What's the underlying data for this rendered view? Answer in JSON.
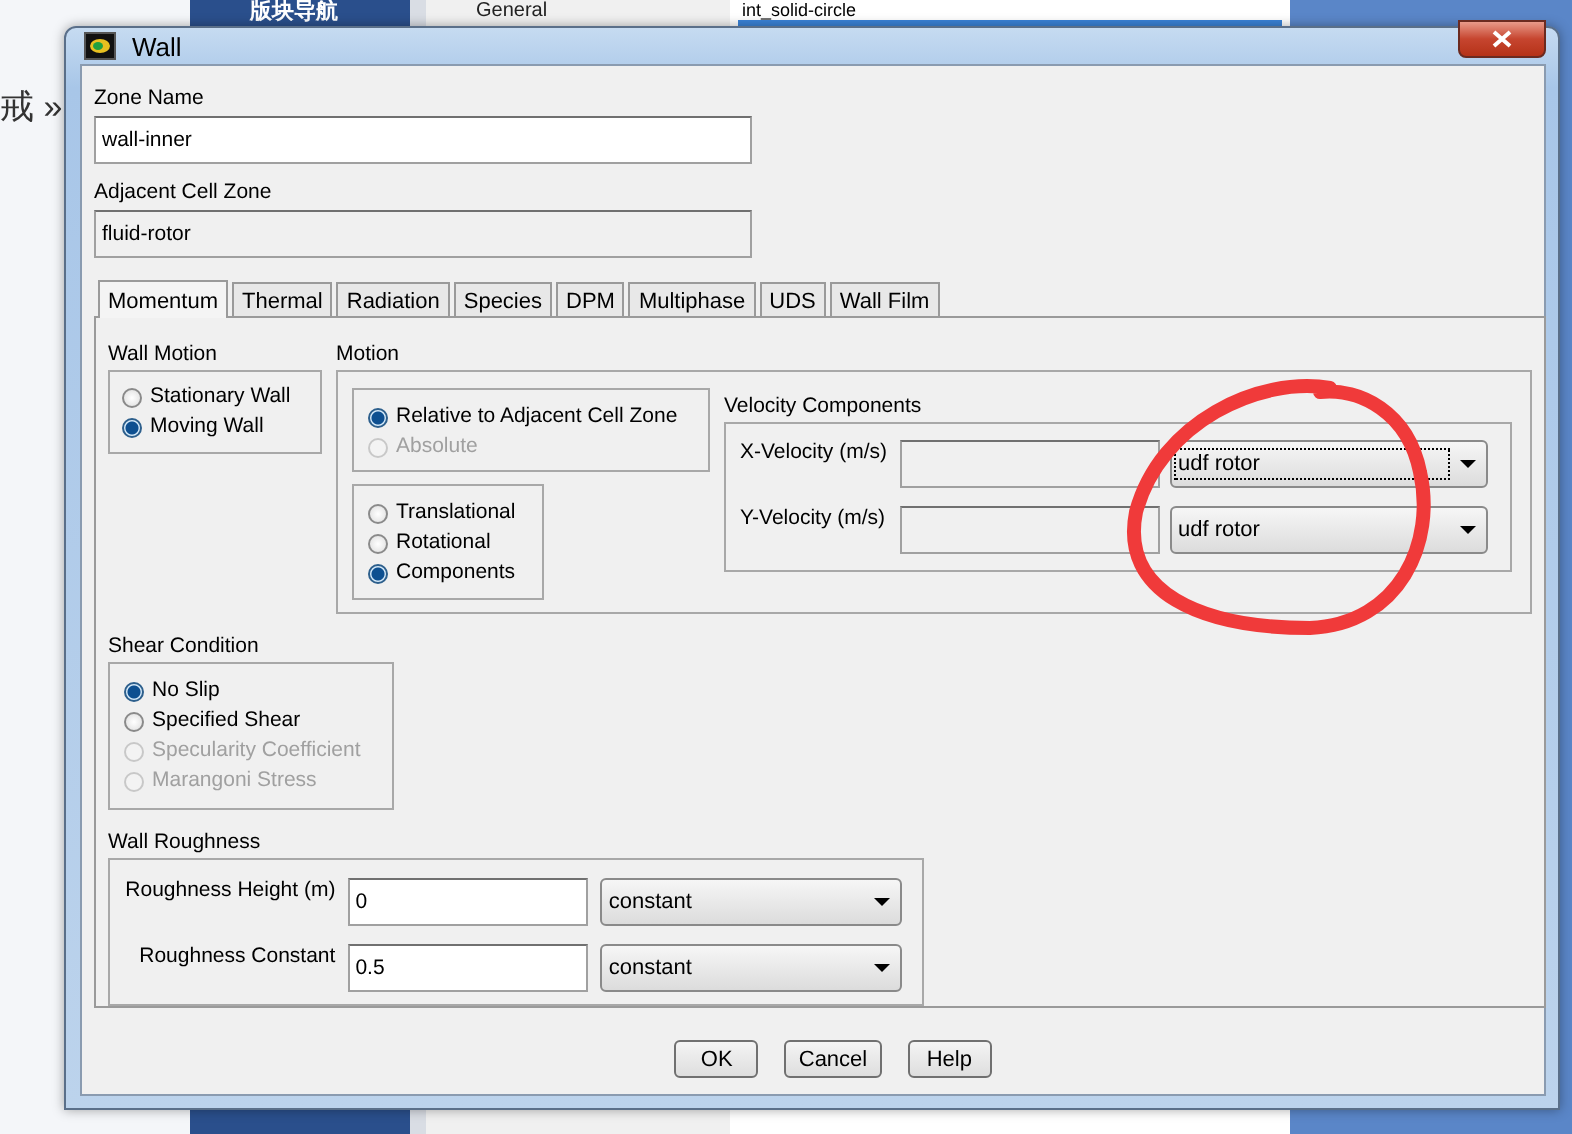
{
  "background": {
    "banner_title": "版块导航",
    "breadcrumb": "戒 »",
    "tree_item": "General",
    "list_items": [
      {
        "label": "int_solid-circle",
        "selected": false
      }
    ]
  },
  "window": {
    "title": "Wall"
  },
  "zone_name": {
    "label": "Zone Name",
    "value": "wall-inner"
  },
  "adjacent_cell_zone": {
    "label": "Adjacent Cell Zone",
    "value": "fluid-rotor"
  },
  "tabs": [
    {
      "label": "Momentum",
      "selected": true
    },
    {
      "label": "Thermal",
      "selected": false
    },
    {
      "label": "Radiation",
      "selected": false
    },
    {
      "label": "Species",
      "selected": false
    },
    {
      "label": "DPM",
      "selected": false
    },
    {
      "label": "Multiphase",
      "selected": false
    },
    {
      "label": "UDS",
      "selected": false
    },
    {
      "label": "Wall Film",
      "selected": false
    }
  ],
  "wall_motion": {
    "title": "Wall Motion",
    "options": [
      {
        "label": "Stationary Wall",
        "selected": false,
        "disabled": false
      },
      {
        "label": "Moving Wall",
        "selected": true,
        "disabled": false
      }
    ]
  },
  "motion": {
    "title": "Motion",
    "reference": [
      {
        "label": "Relative to Adjacent Cell Zone",
        "selected": true,
        "disabled": false
      },
      {
        "label": "Absolute",
        "selected": false,
        "disabled": true
      }
    ],
    "type": [
      {
        "label": "Translational",
        "selected": false,
        "disabled": false
      },
      {
        "label": "Rotational",
        "selected": false,
        "disabled": false
      },
      {
        "label": "Components",
        "selected": true,
        "disabled": false
      }
    ],
    "velocity_components": {
      "title": "Velocity Components",
      "rows": [
        {
          "label": "X-Velocity (m/s)",
          "profile": "udf rotor",
          "focused": true
        },
        {
          "label": "Y-Velocity (m/s)",
          "profile": "udf rotor",
          "focused": false
        }
      ]
    }
  },
  "shear_condition": {
    "title": "Shear Condition",
    "options": [
      {
        "label": "No Slip",
        "selected": true,
        "disabled": false
      },
      {
        "label": "Specified Shear",
        "selected": false,
        "disabled": false
      },
      {
        "label": "Specularity Coefficient",
        "selected": false,
        "disabled": true
      },
      {
        "label": "Marangoni Stress",
        "selected": false,
        "disabled": true
      }
    ]
  },
  "wall_roughness": {
    "title": "Wall Roughness",
    "rows": [
      {
        "label": "Roughness Height (m)",
        "value": "0",
        "method": "constant"
      },
      {
        "label": "Roughness Constant",
        "value": "0.5",
        "method": "constant"
      }
    ]
  },
  "buttons": [
    "OK",
    "Cancel",
    "Help"
  ]
}
